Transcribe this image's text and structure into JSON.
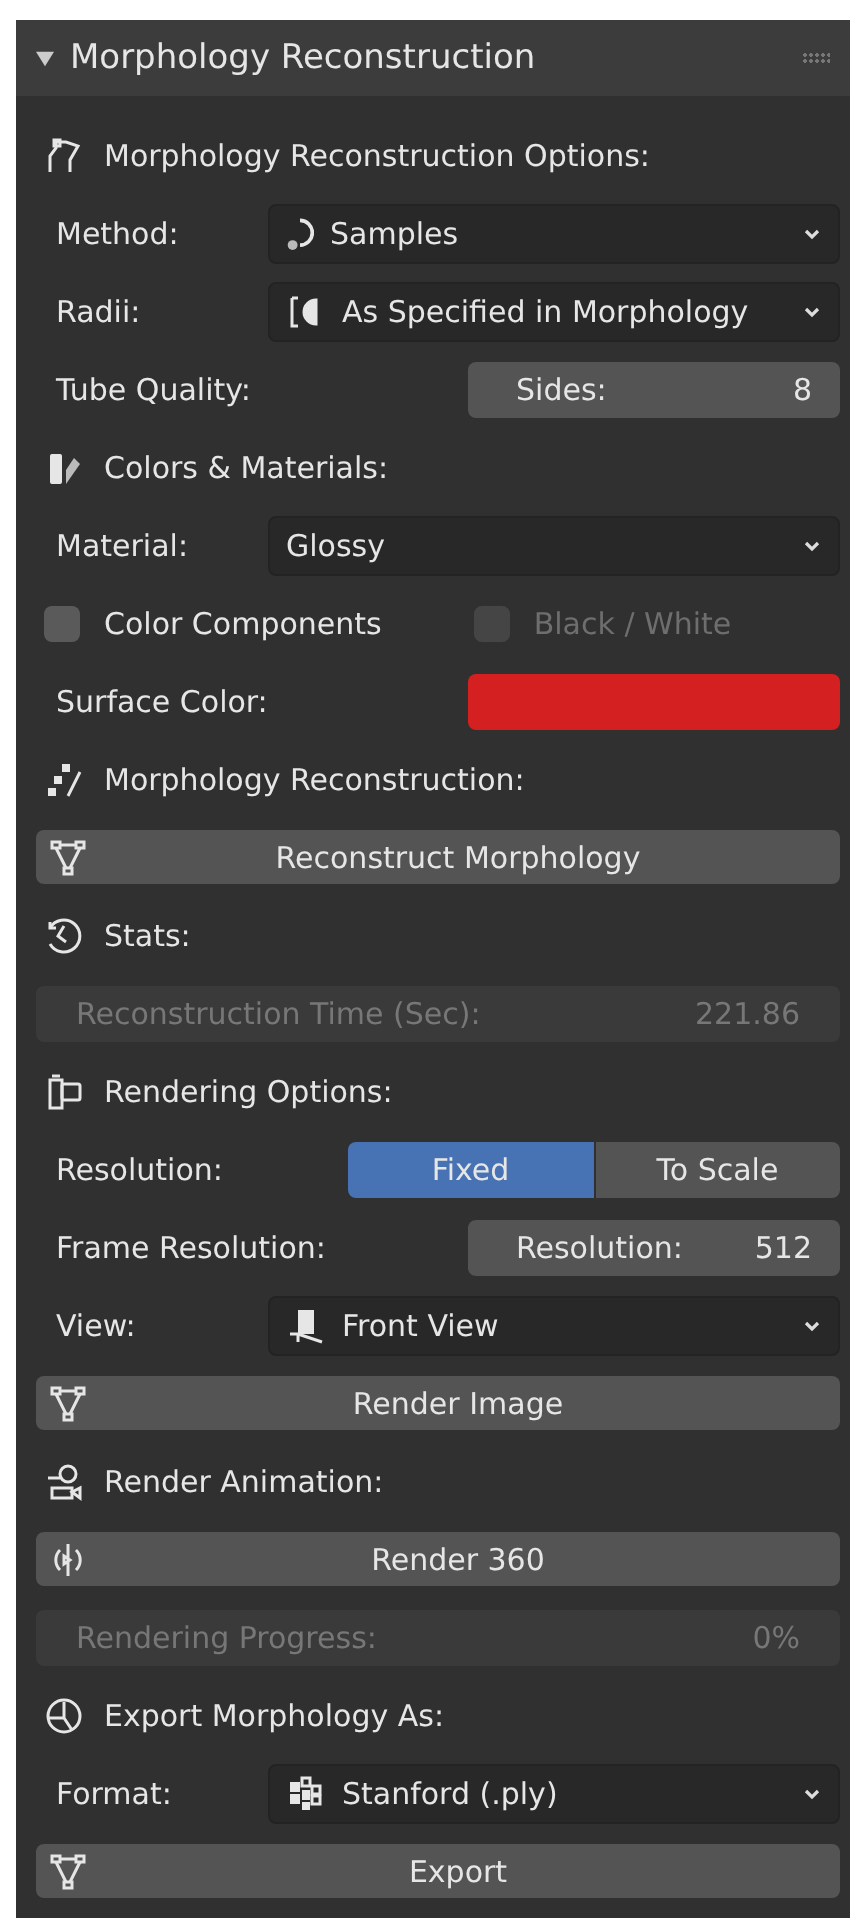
{
  "panel": {
    "title": "Morphology Reconstruction",
    "expanded": true
  },
  "rows": [
    {
      "kind": "section",
      "label": "Morphology Reconstruction Options:"
    },
    {
      "kind": "dropdown",
      "label": "Method:",
      "value": "Samples"
    },
    {
      "kind": "dropdown",
      "label": "Radii:",
      "value": "As Specified in Morphology"
    },
    {
      "kind": "number",
      "label": "Tube Quality:",
      "field": "Sides:",
      "value": "8"
    },
    {
      "kind": "section",
      "label": "Colors & Materials:"
    },
    {
      "kind": "dropdown",
      "label": "Material:",
      "value": "Glossy"
    },
    {
      "kind": "checkboxes",
      "items": [
        {
          "label": "Color Components",
          "checked": false,
          "disabled": false
        },
        {
          "label": "Black / White",
          "checked": false,
          "disabled": true
        }
      ]
    },
    {
      "kind": "color",
      "label": "Surface Color:",
      "color": "#d42020"
    },
    {
      "kind": "section",
      "label": "Morphology Reconstruction:"
    },
    {
      "kind": "button",
      "label": "Reconstruct Morphology"
    },
    {
      "kind": "section",
      "label": "Stats:"
    },
    {
      "kind": "readonly",
      "label": "Reconstruction Time (Sec):",
      "value": "221.86",
      "disabled": true
    },
    {
      "kind": "section",
      "label": "Rendering Options:"
    },
    {
      "kind": "toggle",
      "label": "Resolution:",
      "options": [
        {
          "label": "Fixed",
          "selected": true
        },
        {
          "label": "To Scale",
          "selected": false
        }
      ]
    },
    {
      "kind": "number",
      "label": "Frame Resolution:",
      "field": "Resolution:",
      "value": "512"
    },
    {
      "kind": "dropdown",
      "label": "View:",
      "value": "Front View"
    },
    {
      "kind": "button",
      "label": "Render Image"
    },
    {
      "kind": "section",
      "label": "Render Animation:"
    },
    {
      "kind": "button",
      "label": "Render 360"
    },
    {
      "kind": "readonly",
      "label": "Rendering Progress:",
      "value": "0%",
      "disabled": true
    },
    {
      "kind": "section",
      "label": "Export Morphology As:"
    },
    {
      "kind": "dropdown",
      "label": "Format:",
      "value": "Stanford (.ply)"
    },
    {
      "kind": "button",
      "label": "Export"
    }
  ]
}
